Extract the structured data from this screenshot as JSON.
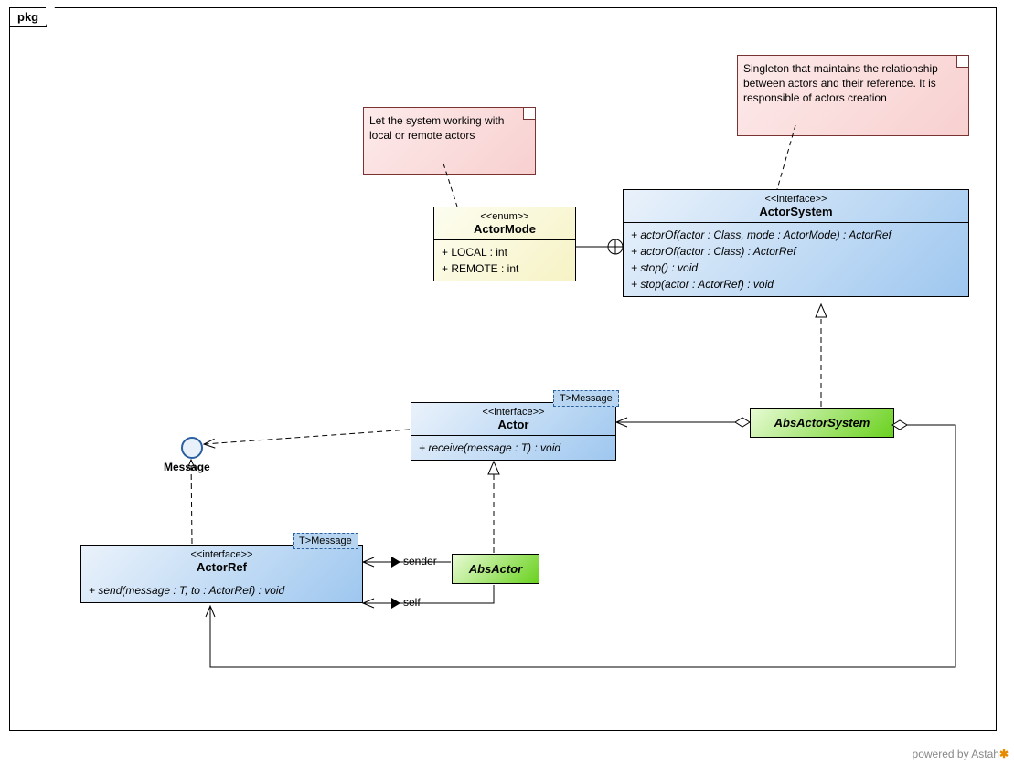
{
  "frame": {
    "name": "pkg"
  },
  "notes": {
    "actorSystemNote": "Singleton that maintains the relationship between actors and their reference. It is responsible of actors creation",
    "actorModeNote": "Let the system working with local or remote actors"
  },
  "classes": {
    "actorSystem": {
      "stereotype": "<<interface>>",
      "name": "ActorSystem",
      "ops": [
        "+ actorOf(actor : Class, mode : ActorMode) : ActorRef",
        "+ actorOf(actor : Class) : ActorRef",
        "+ stop() : void",
        "+ stop(actor : ActorRef) : void"
      ]
    },
    "actorMode": {
      "stereotype": "<<enum>>",
      "name": "ActorMode",
      "attrs": [
        "+ LOCAL : int",
        "+ REMOTE : int"
      ]
    },
    "actor": {
      "stereotype": "<<interface>>",
      "name": "Actor",
      "template": "T>Message",
      "ops": [
        "+ receive(message : T) : void"
      ]
    },
    "actorRef": {
      "stereotype": "<<interface>>",
      "name": "ActorRef",
      "template": "T>Message",
      "ops": [
        "+ send(message : T, to : ActorRef) : void"
      ]
    },
    "absActor": {
      "name": "AbsActor"
    },
    "absActorSystem": {
      "name": "AbsActorSystem"
    }
  },
  "messageInterface": {
    "name": "Message"
  },
  "assoc": {
    "sender": "sender",
    "self": "self"
  },
  "footer": {
    "text": "powered by Astah"
  }
}
